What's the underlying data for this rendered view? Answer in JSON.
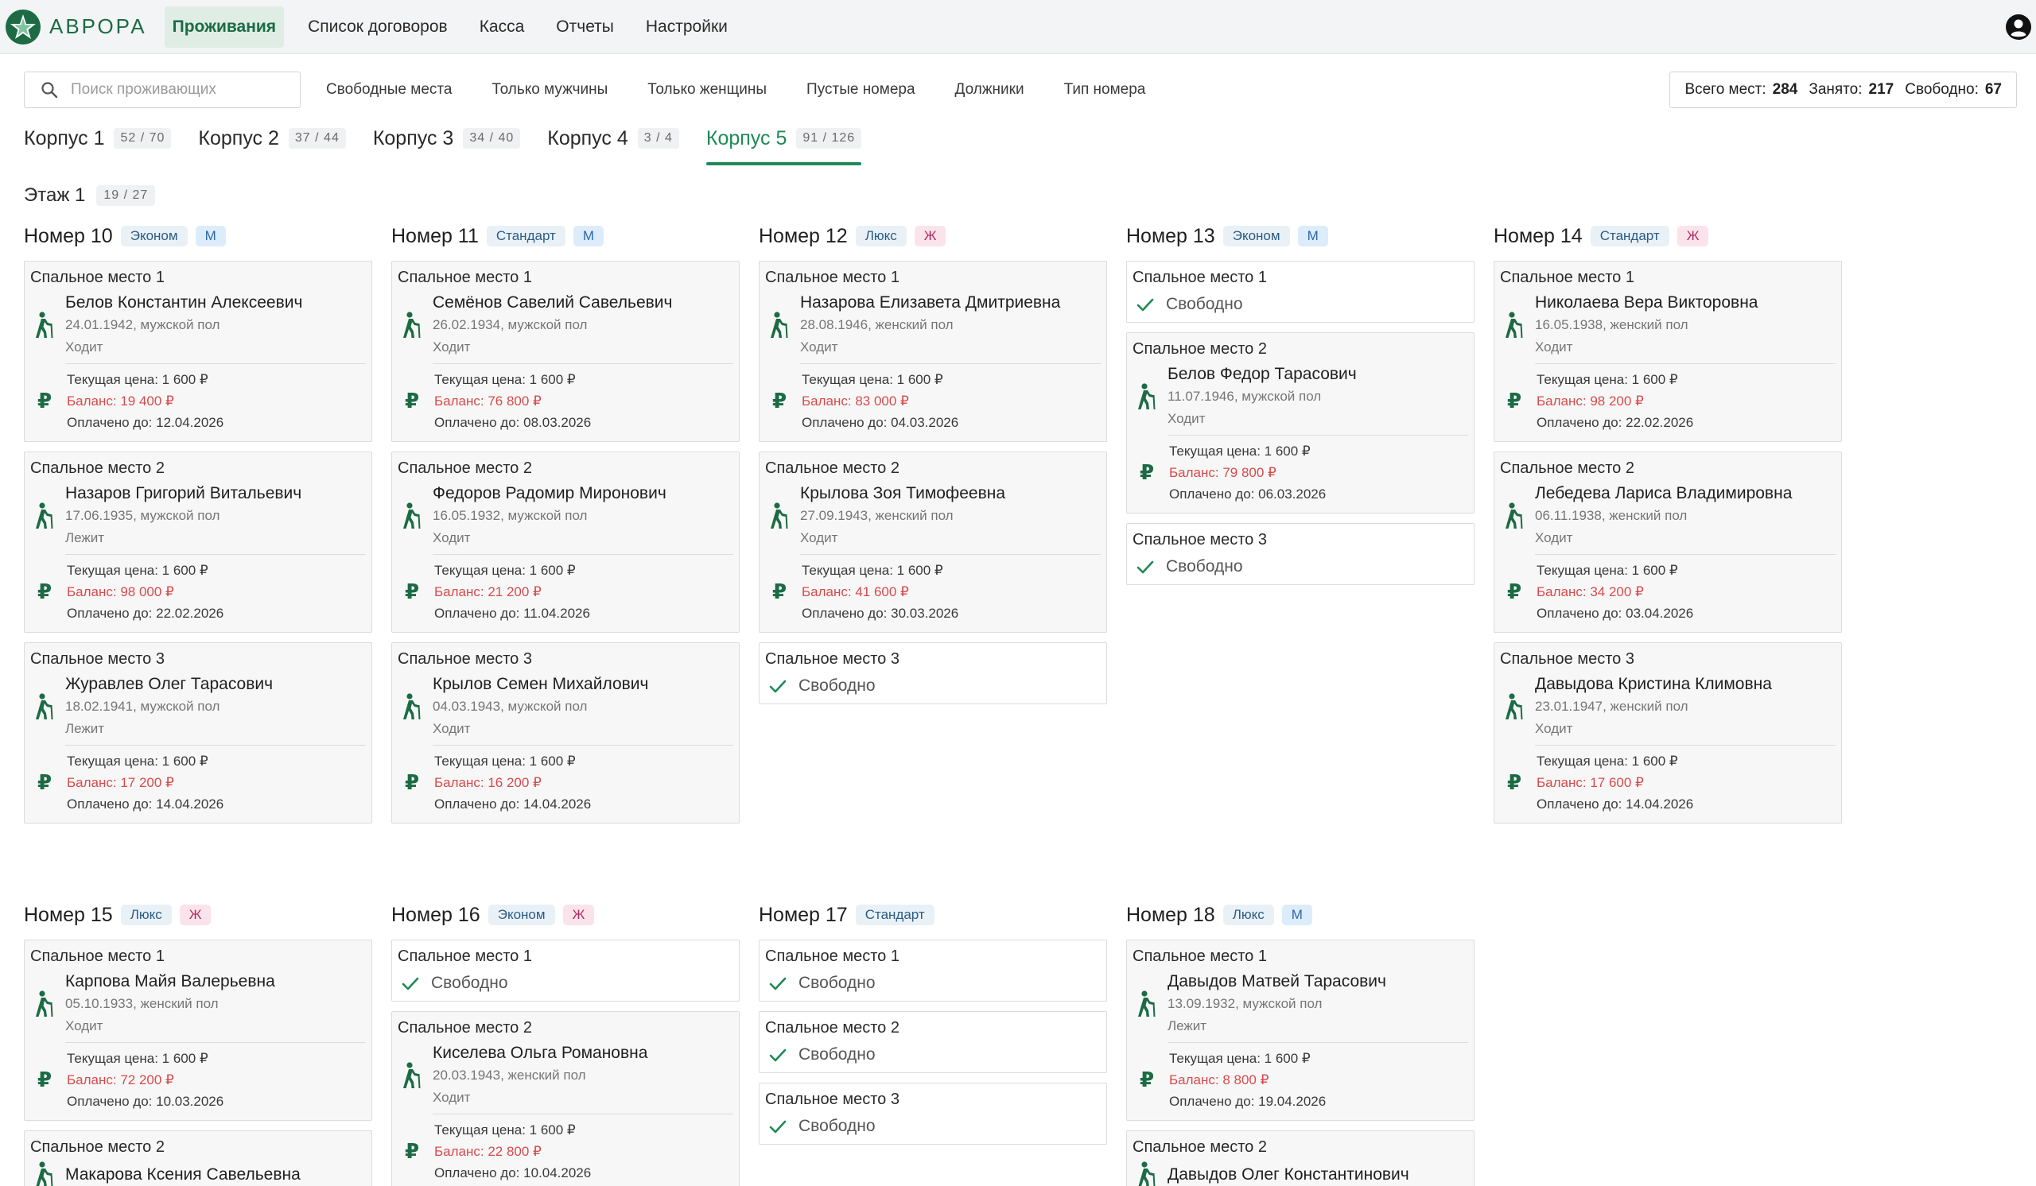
{
  "app": {
    "name": "АВРОРА",
    "colors": {
      "accent": "#1e8a56",
      "debt": "#d84a4a"
    }
  },
  "nav": [
    {
      "label": "Проживания",
      "active": true
    },
    {
      "label": "Список договоров",
      "active": false
    },
    {
      "label": "Касса",
      "active": false
    },
    {
      "label": "Отчеты",
      "active": false
    },
    {
      "label": "Настройки",
      "active": false
    }
  ],
  "search": {
    "placeholder": "Поиск проживающих",
    "value": ""
  },
  "filters": [
    "Свободные места",
    "Только мужчины",
    "Только женщины",
    "Пустые номера",
    "Должники",
    "Тип номера"
  ],
  "stats": {
    "total_label": "Всего мест:",
    "total": "284",
    "occupied_label": "Занято:",
    "occupied": "217",
    "free_label": "Свободно:",
    "free": "67"
  },
  "buildings": [
    {
      "label": "Корпус 1",
      "count": "52 / 70"
    },
    {
      "label": "Корпус 2",
      "count": "37 / 44"
    },
    {
      "label": "Корпус 3",
      "count": "34 / 40"
    },
    {
      "label": "Корпус 4",
      "count": "3 / 4"
    },
    {
      "label": "Корпус 5",
      "count": "91 / 126",
      "active": true
    }
  ],
  "floor": {
    "label": "Этаж 1",
    "count": "19 / 27"
  },
  "labels": {
    "free": "Свободно",
    "price": "Текущая цена: 1 600 ₽",
    "balance_prefix": "Баланс:",
    "paid_prefix": "Оплачено до:"
  },
  "rooms": [
    {
      "title": "Номер 10",
      "type": "Эконом",
      "gender": "М",
      "beds": [
        {
          "title": "Спальное место 1",
          "name": "Белов Константин Алексеевич",
          "meta": "24.01.1942, мужской пол",
          "status": "Ходит",
          "price": "Текущая цена: 1 600 ₽",
          "balance": "Баланс: 19 400 ₽",
          "paid": "Оплачено до: 12.04.2026"
        },
        {
          "title": "Спальное место 2",
          "name": "Назаров Григорий Витальевич",
          "meta": "17.06.1935, мужской пол",
          "status": "Лежит",
          "price": "Текущая цена: 1 600 ₽",
          "balance": "Баланс: 98 000 ₽",
          "paid": "Оплачено до: 22.02.2026"
        },
        {
          "title": "Спальное место 3",
          "name": "Журавлев Олег Тарасович",
          "meta": "18.02.1941, мужской пол",
          "status": "Лежит",
          "price": "Текущая цена: 1 600 ₽",
          "balance": "Баланс: 17 200 ₽",
          "paid": "Оплачено до: 14.04.2026"
        }
      ]
    },
    {
      "title": "Номер 11",
      "type": "Стандарт",
      "gender": "М",
      "beds": [
        {
          "title": "Спальное место 1",
          "name": "Семёнов Савелий Савельевич",
          "meta": "26.02.1934, мужской пол",
          "status": "Ходит",
          "price": "Текущая цена: 1 600 ₽",
          "balance": "Баланс: 76 800 ₽",
          "paid": "Оплачено до: 08.03.2026"
        },
        {
          "title": "Спальное место 2",
          "name": "Федоров Радомир Миронович",
          "meta": "16.05.1932, мужской пол",
          "status": "Ходит",
          "price": "Текущая цена: 1 600 ₽",
          "balance": "Баланс: 21 200 ₽",
          "paid": "Оплачено до: 11.04.2026"
        },
        {
          "title": "Спальное место 3",
          "name": "Крылов Семен Михайлович",
          "meta": "04.03.1943, мужской пол",
          "status": "Ходит",
          "price": "Текущая цена: 1 600 ₽",
          "balance": "Баланс: 16 200 ₽",
          "paid": "Оплачено до: 14.04.2026"
        }
      ]
    },
    {
      "title": "Номер 12",
      "type": "Люкс",
      "gender": "Ж",
      "beds": [
        {
          "title": "Спальное место 1",
          "name": "Назарова Елизавета Дмитриевна",
          "meta": "28.08.1946, женский пол",
          "status": "Ходит",
          "price": "Текущая цена: 1 600 ₽",
          "balance": "Баланс: 83 000 ₽",
          "paid": "Оплачено до: 04.03.2026"
        },
        {
          "title": "Спальное место 2",
          "name": "Крылова Зоя Тимофеевна",
          "meta": "27.09.1943, женский пол",
          "status": "Ходит",
          "price": "Текущая цена: 1 600 ₽",
          "balance": "Баланс: 41 600 ₽",
          "paid": "Оплачено до: 30.03.2026"
        },
        {
          "title": "Спальное место 3",
          "free": true
        }
      ]
    },
    {
      "title": "Номер 13",
      "type": "Эконом",
      "gender": "М",
      "beds": [
        {
          "title": "Спальное место 1",
          "free": true
        },
        {
          "title": "Спальное место 2",
          "name": "Белов Федор Тарасович",
          "meta": "11.07.1946, мужской пол",
          "status": "Ходит",
          "price": "Текущая цена: 1 600 ₽",
          "balance": "Баланс: 79 800 ₽",
          "paid": "Оплачено до: 06.03.2026"
        },
        {
          "title": "Спальное место 3",
          "free": true
        }
      ]
    },
    {
      "title": "Номер 14",
      "type": "Стандарт",
      "gender": "Ж",
      "beds": [
        {
          "title": "Спальное место 1",
          "name": "Николаева Вера Викторовна",
          "meta": "16.05.1938, женский пол",
          "status": "Ходит",
          "price": "Текущая цена: 1 600 ₽",
          "balance": "Баланс: 98 200 ₽",
          "paid": "Оплачено до: 22.02.2026"
        },
        {
          "title": "Спальное место 2",
          "name": "Лебедева Лариса Владимировна",
          "meta": "06.11.1938, женский пол",
          "status": "Ходит",
          "price": "Текущая цена: 1 600 ₽",
          "balance": "Баланс: 34 200 ₽",
          "paid": "Оплачено до: 03.04.2026"
        },
        {
          "title": "Спальное место 3",
          "name": "Давыдова Кристина Климовна",
          "meta": "23.01.1947, женский пол",
          "status": "Ходит",
          "price": "Текущая цена: 1 600 ₽",
          "balance": "Баланс: 17 600 ₽",
          "paid": "Оплачено до: 14.04.2026"
        }
      ]
    },
    {
      "title": "Номер 15",
      "type": "Люкс",
      "gender": "Ж",
      "beds": [
        {
          "title": "Спальное место 1",
          "name": "Карпова Майя Валерьевна",
          "meta": "05.10.1933, женский пол",
          "status": "Ходит",
          "price": "Текущая цена: 1 600 ₽",
          "balance": "Баланс: 72 200 ₽",
          "paid": "Оплачено до: 10.03.2026"
        },
        {
          "title": "Спальное место 2",
          "name": "Макарова Ксения Савельевна",
          "meta": "",
          "status": "",
          "price": "",
          "balance": "",
          "paid": ""
        }
      ]
    },
    {
      "title": "Номер 16",
      "type": "Эконом",
      "gender": "Ж",
      "beds": [
        {
          "title": "Спальное место 1",
          "free": true
        },
        {
          "title": "Спальное место 2",
          "name": "Киселева Ольга Романовна",
          "meta": "20.03.1943, женский пол",
          "status": "Ходит",
          "price": "Текущая цена: 1 600 ₽",
          "balance": "Баланс: 22 800 ₽",
          "paid": "Оплачено до: 10.04.2026"
        }
      ]
    },
    {
      "title": "Номер 17",
      "type": "Стандарт",
      "gender": "",
      "beds": [
        {
          "title": "Спальное место 1",
          "free": true
        },
        {
          "title": "Спальное место 2",
          "free": true
        },
        {
          "title": "Спальное место 3",
          "free": true
        }
      ]
    },
    {
      "title": "Номер 18",
      "type": "Люкс",
      "gender": "М",
      "beds": [
        {
          "title": "Спальное место 1",
          "name": "Давыдов Матвей Тарасович",
          "meta": "13.09.1932, мужской пол",
          "status": "Лежит",
          "price": "Текущая цена: 1 600 ₽",
          "balance": "Баланс: 8 800 ₽",
          "paid": "Оплачено до: 19.04.2026"
        },
        {
          "title": "Спальное место 2",
          "name": "Давыдов Олег Константинович",
          "meta": "",
          "status": "",
          "price": "",
          "balance": "",
          "paid": ""
        }
      ]
    }
  ]
}
